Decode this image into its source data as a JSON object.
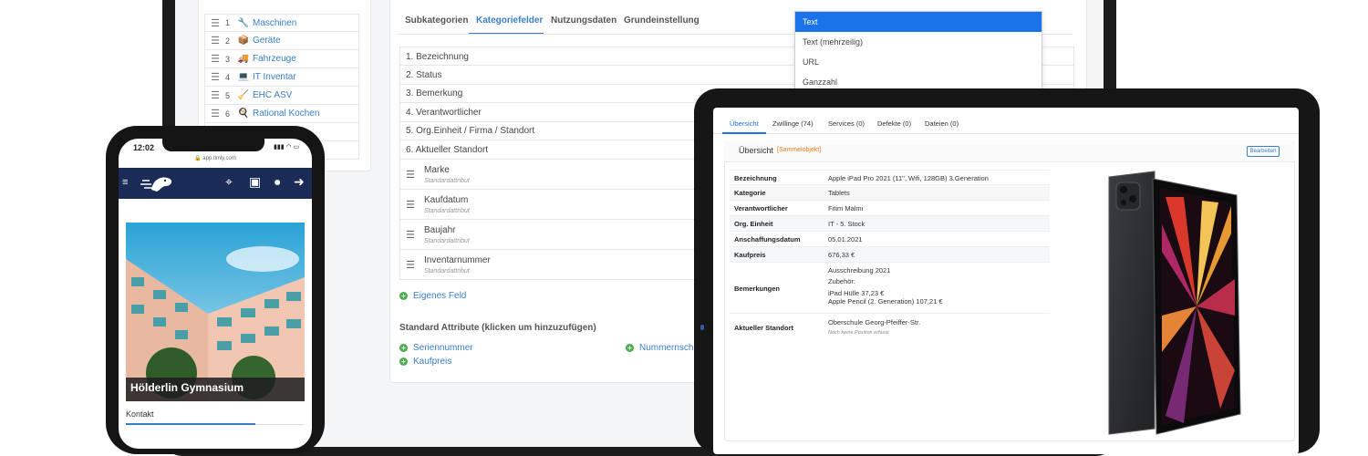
{
  "admin": {
    "categories": [
      {
        "num": "1",
        "icon": "wrench-icon",
        "glyph": "🔧",
        "label": "Maschinen"
      },
      {
        "num": "2",
        "icon": "box-icon",
        "glyph": "📦",
        "label": "Geräte"
      },
      {
        "num": "3",
        "icon": "truck-icon",
        "glyph": "🚚",
        "label": "Fahrzeuge"
      },
      {
        "num": "4",
        "icon": "computer-icon",
        "glyph": "💻",
        "label": "IT Inventar"
      },
      {
        "num": "5",
        "icon": "broom-icon",
        "glyph": "🧹",
        "label": "EHC ASV"
      },
      {
        "num": "6",
        "icon": "chef-icon",
        "glyph": "🍳",
        "label": "Rational Kochen"
      }
    ],
    "tabs": [
      "Subkategorien",
      "Kategoriefelder",
      "Nutzungsdaten",
      "Grundeinstellung"
    ],
    "active_tab": "Kategoriefelder",
    "fields": [
      "1. Bezeichnung",
      "2. Status",
      "3. Bemerkung",
      "4. Verantwortlicher",
      "5. Org.Einheit / Firma / Standort",
      "6. Aktueller Standort"
    ],
    "attributes": [
      {
        "name": "Marke",
        "sub": "Standardattribut"
      },
      {
        "name": "Kaufdatum",
        "sub": "Standardattribut"
      },
      {
        "name": "Baujahr",
        "sub": "Standardattribut"
      },
      {
        "name": "Inventarnummer",
        "sub": "Standardattribut"
      }
    ],
    "add_custom_field": "Eigenes Feld",
    "standard_attributes_title": "Standard Attribute (klicken um hinzuzufügen)",
    "standard_attributes": [
      "Seriennummer",
      "Kaufpreis",
      "Nummernschi"
    ],
    "dropdown_options": [
      "Text",
      "Text (mehrzeilig)",
      "URL",
      "Ganzzahl"
    ],
    "dropdown_selected": "Text"
  },
  "phone": {
    "time": "12:02",
    "url": "app.timly.com",
    "school_name": "Hölderlin Gymnasium",
    "kontakt_tab": "Kontakt",
    "header_color": "#1a2b57"
  },
  "tablet": {
    "tabs": [
      "Übersicht",
      "Zwillinge (74)",
      "Services (0)",
      "Defekte (0)",
      "Dateien (0)"
    ],
    "active_tab": "Übersicht",
    "card_title": "Übersicht",
    "card_badge": "[Sammelobjekt]",
    "edit_button": "Bearbeiten",
    "details": [
      {
        "key": "Bezeichnung",
        "value": "Apple iPad Pro 2021 (11\", Wifi, 128GB) 3.Generation"
      },
      {
        "key": "Kategorie",
        "value": "Tablets"
      },
      {
        "key": "Verantwortlicher",
        "value": "Fitim Malmi"
      },
      {
        "key": "Org. Einheit",
        "value": "IT - 5. Stock"
      },
      {
        "key": "Anschaffungsdatum",
        "value": "05.01.2021"
      },
      {
        "key": "Kaufpreis",
        "value": "676,33 €"
      }
    ],
    "remarks": {
      "key": "Bemerkungen",
      "line1": "Ausschreibung 2021",
      "line2": "Zubehör:",
      "line3": "iPad Hülle 37,23 €",
      "line4": "Apple Pencil (2. Generation) 107,21 €"
    },
    "location": {
      "key": "Aktueller Standort",
      "value": "Oberschule Georg-Pfeiffer-Str.",
      "note": "Noch keine Position erfasst"
    },
    "accent_color": "#1a73e8"
  }
}
